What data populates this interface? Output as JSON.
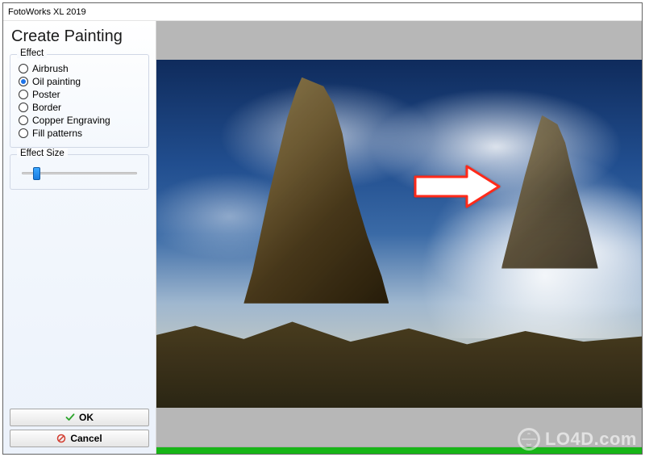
{
  "window": {
    "title": "FotoWorks XL 2019"
  },
  "heading": "Create Painting",
  "effects": {
    "legend": "Effect",
    "options": [
      {
        "label": "Airbrush",
        "checked": false
      },
      {
        "label": "Oil painting",
        "checked": true
      },
      {
        "label": "Poster",
        "checked": false
      },
      {
        "label": "Border",
        "checked": false
      },
      {
        "label": "Copper Engraving",
        "checked": false
      },
      {
        "label": "Fill patterns",
        "checked": false
      }
    ]
  },
  "size": {
    "legend": "Effect Size",
    "value_pct": 10
  },
  "buttons": {
    "ok": "OK",
    "cancel": "Cancel"
  },
  "progress": {
    "pct": 100
  },
  "watermark": "LO4D.com"
}
